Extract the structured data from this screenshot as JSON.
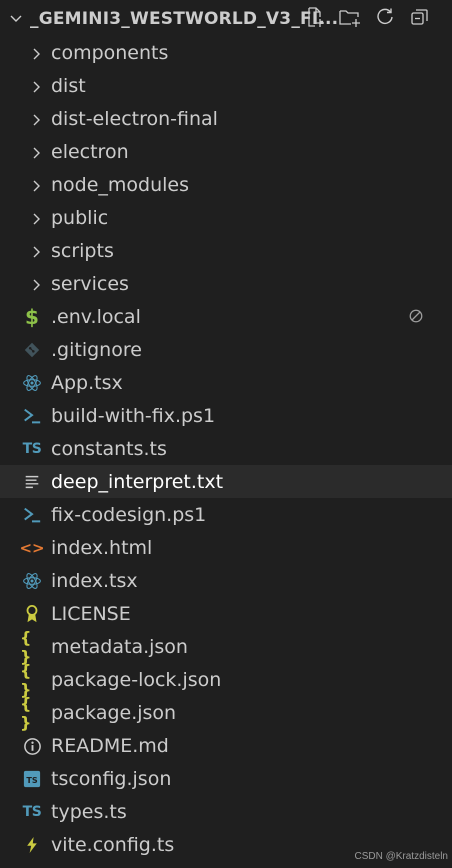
{
  "explorer": {
    "title": "_GEMINI3_WESTWORLD_V3_FI...",
    "actions": [
      {
        "name": "new-file-icon"
      },
      {
        "name": "new-folder-icon"
      },
      {
        "name": "refresh-icon"
      },
      {
        "name": "collapse-all-icon"
      }
    ]
  },
  "tree": [
    {
      "label": "components",
      "type": "folder"
    },
    {
      "label": "dist",
      "type": "folder"
    },
    {
      "label": "dist-electron-final",
      "type": "folder"
    },
    {
      "label": "electron",
      "type": "folder"
    },
    {
      "label": "node_modules",
      "type": "folder"
    },
    {
      "label": "public",
      "type": "folder"
    },
    {
      "label": "scripts",
      "type": "folder"
    },
    {
      "label": "services",
      "type": "folder"
    },
    {
      "label": ".env.local",
      "type": "file",
      "icon": "dollar-icon",
      "status": "ignored-icon"
    },
    {
      "label": ".gitignore",
      "type": "file",
      "icon": "git-icon"
    },
    {
      "label": "App.tsx",
      "type": "file",
      "icon": "react-icon"
    },
    {
      "label": "build-with-fix.ps1",
      "type": "file",
      "icon": "powershell-icon"
    },
    {
      "label": "constants.ts",
      "type": "file",
      "icon": "typescript-icon"
    },
    {
      "label": "deep_interpret.txt",
      "type": "file",
      "icon": "text-file-icon",
      "selected": true
    },
    {
      "label": "fix-codesign.ps1",
      "type": "file",
      "icon": "powershell-icon"
    },
    {
      "label": "index.html",
      "type": "file",
      "icon": "html-icon"
    },
    {
      "label": "index.tsx",
      "type": "file",
      "icon": "react-icon"
    },
    {
      "label": "LICENSE",
      "type": "file",
      "icon": "license-icon"
    },
    {
      "label": "metadata.json",
      "type": "file",
      "icon": "json-icon"
    },
    {
      "label": "package-lock.json",
      "type": "file",
      "icon": "json-icon"
    },
    {
      "label": "package.json",
      "type": "file",
      "icon": "json-icon"
    },
    {
      "label": "README.md",
      "type": "file",
      "icon": "info-icon"
    },
    {
      "label": "tsconfig.json",
      "type": "file",
      "icon": "tsconfig-icon"
    },
    {
      "label": "types.ts",
      "type": "file",
      "icon": "typescript-icon"
    },
    {
      "label": "vite.config.ts",
      "type": "file",
      "icon": "vite-icon"
    }
  ],
  "icon_text": {
    "typescript": "TS",
    "dollar": "$",
    "json": "{ }",
    "html": "<>"
  },
  "colors": {
    "background": "#1f1f1f",
    "selected_row": "#2b2b2b",
    "text": "#cccccc",
    "typescript": "#519aba",
    "json": "#cbcb41",
    "html": "#e37933",
    "env": "#8dc149",
    "react": "#519aba",
    "license": "#cbcb41",
    "vite": "#cbcb41"
  },
  "watermark": "CSDN @Kratzdisteln"
}
